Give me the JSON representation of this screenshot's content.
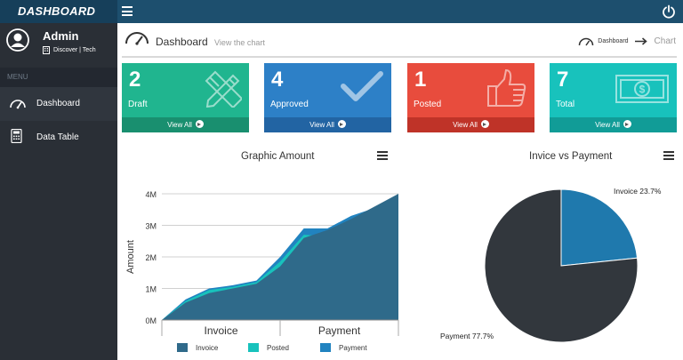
{
  "app": {
    "brand": "DASHBOARD"
  },
  "topbar": {
    "menu_icon": "hamburger-icon",
    "power_icon": "power-icon"
  },
  "user": {
    "name": "Admin",
    "company": "Discover | Tech"
  },
  "sidebar": {
    "menu_title": "MENU",
    "items": [
      {
        "label": "Dashboard",
        "icon": "gauge-icon",
        "active": true
      },
      {
        "label": "Data Table",
        "icon": "calculator-icon",
        "active": false
      }
    ]
  },
  "page": {
    "title": "Dashboard",
    "subtitle": "View the chart",
    "breadcrumb": {
      "home": "Dashboard",
      "current": "Chart"
    }
  },
  "cards": [
    {
      "count": "2",
      "label": "Draft",
      "link": "View All",
      "icon": "pencil-ruler-icon",
      "color": "#20b58f",
      "footer_color": "#198f6f"
    },
    {
      "count": "4",
      "label": "Approved",
      "link": "View All",
      "icon": "checkmark-icon",
      "color": "#2d80c7",
      "footer_color": "#2264a3"
    },
    {
      "count": "1",
      "label": "Posted",
      "link": "View All",
      "icon": "thumbs-up-icon",
      "color": "#e84c3d",
      "footer_color": "#bf3328"
    },
    {
      "count": "7",
      "label": "Total",
      "link": "View All",
      "icon": "money-icon",
      "color": "#18c2bc",
      "footer_color": "#119c97"
    }
  ],
  "area_panel": {
    "title": "Graphic Amount"
  },
  "pie_panel": {
    "title": "Invice vs Payment"
  },
  "chart_data": [
    {
      "type": "area",
      "title": "Graphic Amount",
      "ylabel": "Amount",
      "xlabel": "",
      "categories": [
        "Invoice",
        "Payment"
      ],
      "y_ticks": [
        "0M",
        "1M",
        "2M",
        "3M",
        "4M"
      ],
      "ylim": [
        0,
        4000000
      ],
      "grid": true,
      "legend_position": "bottom",
      "x": [
        0,
        0.1,
        0.2,
        0.3,
        0.4,
        0.5,
        0.6,
        0.7,
        0.8,
        0.9,
        1.0
      ],
      "series": [
        {
          "name": "Invoice",
          "color": "#2f6a8a",
          "values": [
            0,
            550000,
            850000,
            1000000,
            1150000,
            1700000,
            2600000,
            2850000,
            3200000,
            3600000,
            4000000
          ]
        },
        {
          "name": "Posted",
          "color": "#18c2bc",
          "values": [
            0,
            600000,
            950000,
            1050000,
            1200000,
            1850000,
            2700000,
            2650000,
            3100000,
            3500000,
            3950000
          ]
        },
        {
          "name": "Payment",
          "color": "#2183c0",
          "values": [
            0,
            650000,
            1000000,
            1100000,
            1250000,
            2000000,
            2900000,
            2900000,
            3300000,
            3550000,
            3900000
          ]
        }
      ]
    },
    {
      "type": "pie",
      "title": "Invice vs Payment",
      "slices": [
        {
          "name": "Invoice",
          "label": "Invoice 23.7%",
          "value": 23.7,
          "color": "#1f79ad"
        },
        {
          "name": "Payment",
          "label": "Payment 77.7%",
          "value": 77.7,
          "color": "#32373d"
        }
      ]
    }
  ]
}
